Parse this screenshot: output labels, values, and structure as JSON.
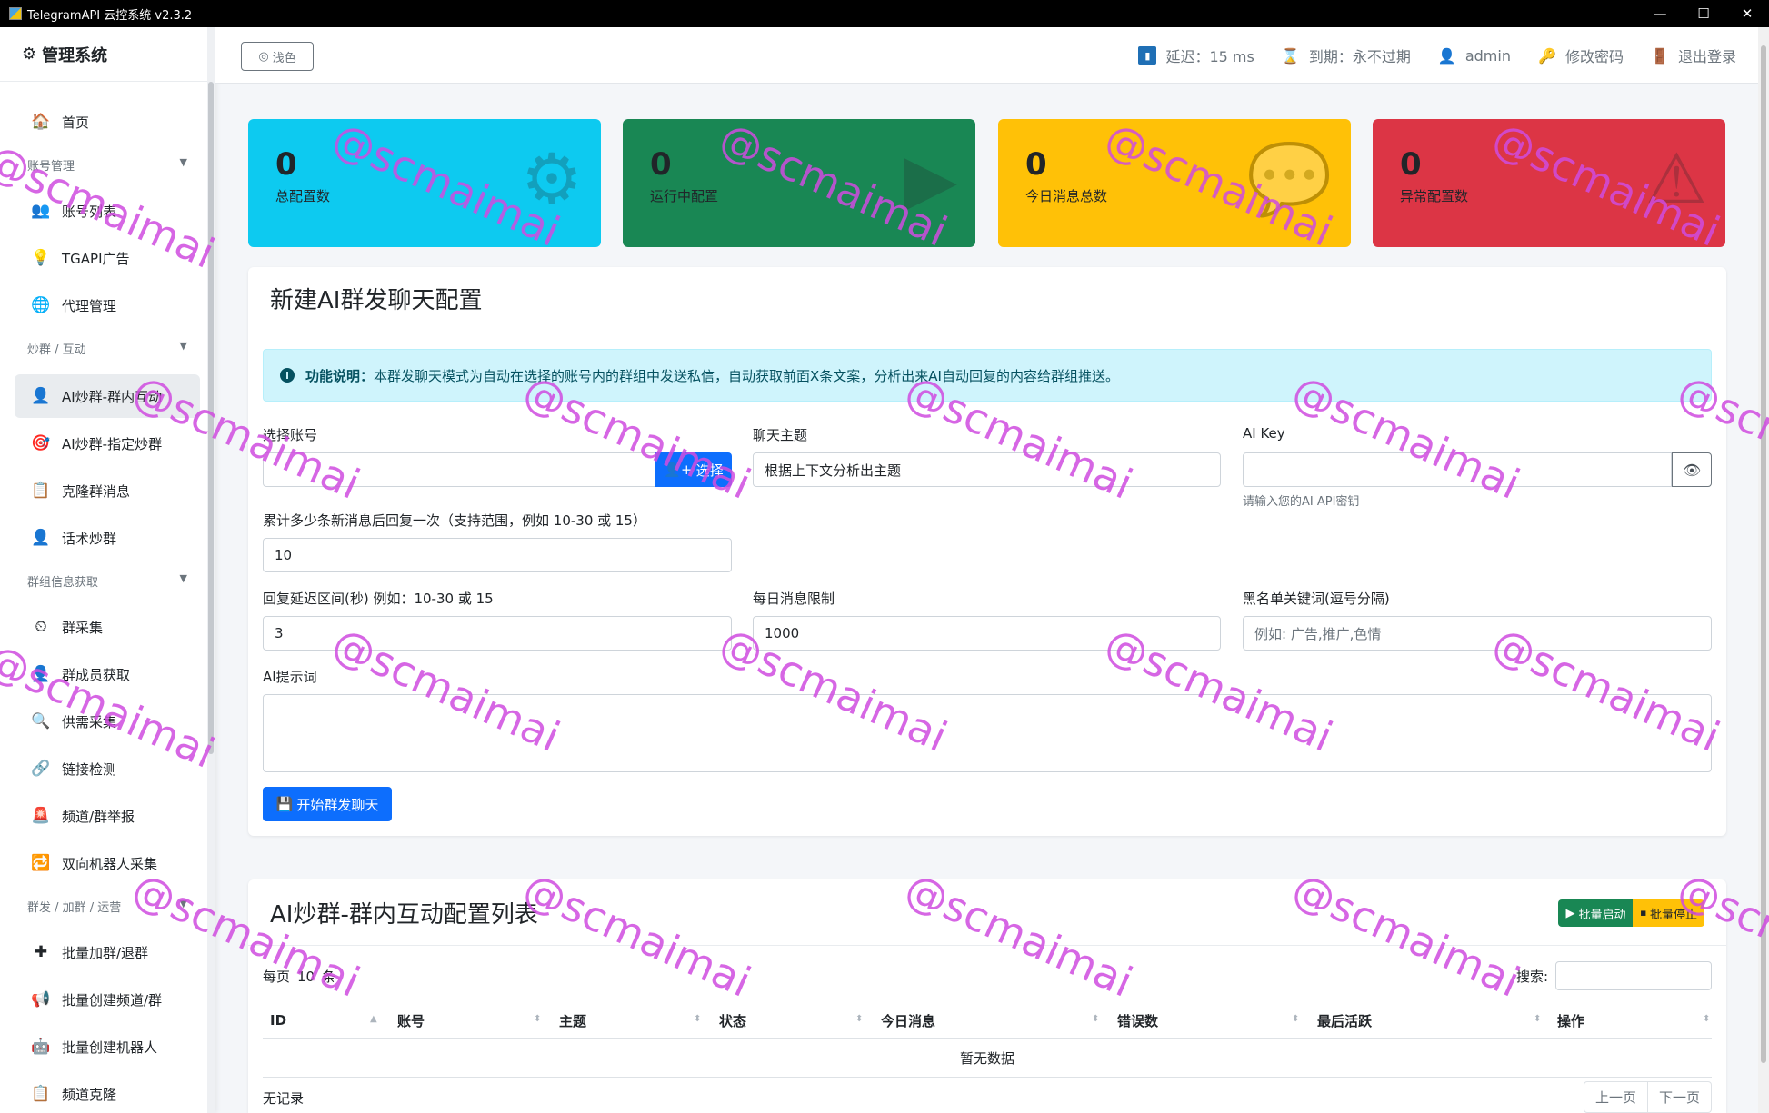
{
  "window": {
    "title": "TelegramAPI 云控系统 v2.3.2",
    "minimize": "—",
    "maximize": "☐",
    "close": "✕"
  },
  "sidebar": {
    "brand": "管理系统",
    "items": [
      {
        "label": "首页",
        "icon": "🏠"
      },
      {
        "label": "账号列表",
        "icon": "👥"
      },
      {
        "label": "TGAPI广告",
        "icon": "💡"
      },
      {
        "label": "代理管理",
        "icon": "🌐"
      },
      {
        "label": "AI炒群-群内互动",
        "icon": "👤"
      },
      {
        "label": "AI炒群-指定炒群",
        "icon": "🎯"
      },
      {
        "label": "克隆群消息",
        "icon": "📋"
      },
      {
        "label": "话术炒群",
        "icon": "👤"
      },
      {
        "label": "群采集",
        "icon": "⏲"
      },
      {
        "label": "群成员获取",
        "icon": "👤"
      },
      {
        "label": "供需采集",
        "icon": "🔍"
      },
      {
        "label": "链接检测",
        "icon": "🔗"
      },
      {
        "label": "频道/群举报",
        "icon": "🚨"
      },
      {
        "label": "双向机器人采集",
        "icon": "🔁"
      },
      {
        "label": "批量加群/退群",
        "icon": "✚"
      },
      {
        "label": "批量创建频道/群",
        "icon": "📢"
      },
      {
        "label": "批量创建机器人",
        "icon": "🤖"
      },
      {
        "label": "频道克隆",
        "icon": "📋"
      }
    ],
    "groups": [
      "账号管理",
      "炒群 / 互动",
      "群组信息获取",
      "群发 / 加群 / 运营"
    ]
  },
  "topbar": {
    "theme_button": "浅色",
    "latency": "延迟：15 ms",
    "expiry": "到期：永不过期",
    "user": "admin",
    "change_password": "修改密码",
    "logout": "退出登录"
  },
  "stats": [
    {
      "value": "0",
      "label": "总配置数",
      "color": "#0dcaf0",
      "icon": "⚙"
    },
    {
      "value": "0",
      "label": "运行中配置",
      "color": "#198754",
      "icon": "▶"
    },
    {
      "value": "0",
      "label": "今日消息总数",
      "color": "#ffc107",
      "icon": "💬"
    },
    {
      "value": "0",
      "label": "异常配置数",
      "color": "#dc3545",
      "icon": "⚠"
    }
  ],
  "form": {
    "title": "新建AI群发聊天配置",
    "info_bold": "功能说明：",
    "info_text": "本群发聊天模式为自动在选择的账号内的群组中发送私信，自动获取前面X条文案，分析出来AI自动回复的内容给群组推送。",
    "account_label": "选择账号",
    "account_value": "",
    "select_button": "选择",
    "topic_label": "聊天主题",
    "topic_value": "根据上下文分析出主题",
    "aikey_label": "AI Key",
    "aikey_value": "",
    "aikey_hint": "请输入您的AI API密钥",
    "threshold_label": "累计多少条新消息后回复一次（支持范围，例如 10-30 或 15）",
    "threshold_value": "10",
    "delay_label": "回复延迟区间(秒) 例如：10-30 或 15",
    "delay_value": "3",
    "daily_label": "每日消息限制",
    "daily_value": "1000",
    "blacklist_label": "黑名单关键词(逗号分隔)",
    "blacklist_placeholder": "例如: 广告,推广,色情",
    "prompt_label": "AI提示词",
    "prompt_value": "",
    "submit_button": "开始群发聊天"
  },
  "table": {
    "title": "AI炒群-群内互动配置列表",
    "batch_start": "批量启动",
    "batch_stop": "批量停止",
    "per_page_prefix": "每页",
    "per_page_value": "10",
    "per_page_suffix": "条",
    "search_label": "搜索:",
    "columns": [
      "ID",
      "账号",
      "主题",
      "状态",
      "今日消息",
      "错误数",
      "最后活跃",
      "操作"
    ],
    "empty": "暂无数据",
    "footer": "无记录",
    "prev": "上一页",
    "next": "下一页"
  },
  "watermark": "@scmaimai"
}
